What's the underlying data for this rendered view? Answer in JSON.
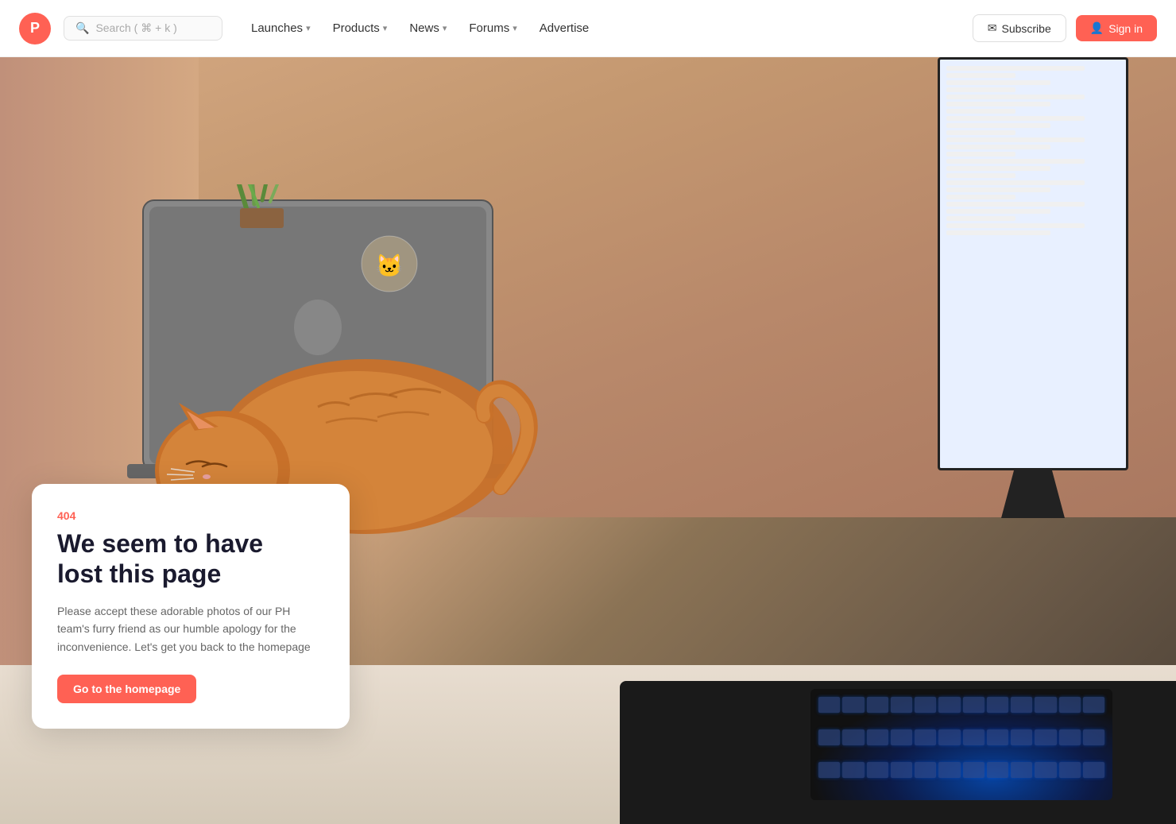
{
  "brand": {
    "logo_letter": "P",
    "logo_color": "#ff6154"
  },
  "nav": {
    "search_placeholder": "Search ( ⌘ + k )",
    "links": [
      {
        "label": "Launches",
        "has_dropdown": true
      },
      {
        "label": "Products",
        "has_dropdown": true
      },
      {
        "label": "News",
        "has_dropdown": true
      },
      {
        "label": "Forums",
        "has_dropdown": true
      },
      {
        "label": "Advertise",
        "has_dropdown": false
      }
    ],
    "subscribe_label": "Subscribe",
    "signin_label": "Sign in"
  },
  "error": {
    "code": "404",
    "title_line1": "We seem to have",
    "title_line2": "lost this page",
    "description": "Please accept these adorable photos of our PH team's furry friend as our humble apology for the inconvenience. Let's get you back to the homepage",
    "cta_label": "Go to the homepage"
  }
}
